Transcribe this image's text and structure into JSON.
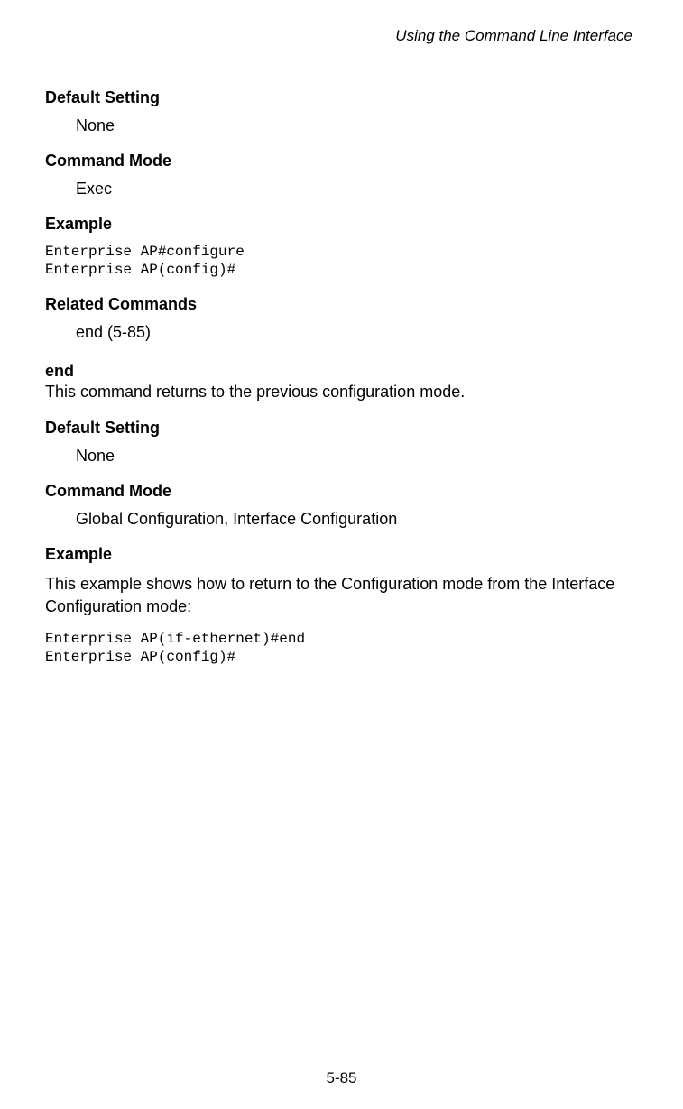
{
  "header": {
    "title": "Using the Command Line Interface"
  },
  "section1": {
    "default_setting_label": "Default Setting",
    "default_setting_value": "None",
    "command_mode_label": "Command Mode",
    "command_mode_value": "Exec",
    "example_label": "Example",
    "example_code": "Enterprise AP#configure\nEnterprise AP(config)#",
    "related_commands_label": "Related Commands",
    "related_commands_value": "end (5-85)"
  },
  "section2": {
    "cmd_name": "end",
    "cmd_desc": "This command returns to the previous configuration mode.",
    "default_setting_label": "Default Setting",
    "default_setting_value": "None",
    "command_mode_label": "Command Mode",
    "command_mode_value": "Global Configuration, Interface Configuration",
    "example_label": "Example",
    "example_intro": "This example shows how to return to the Configuration mode from the Interface Configuration mode:",
    "example_code": "Enterprise AP(if-ethernet)#end\nEnterprise AP(config)#"
  },
  "footer": {
    "page_number": "5-85"
  }
}
